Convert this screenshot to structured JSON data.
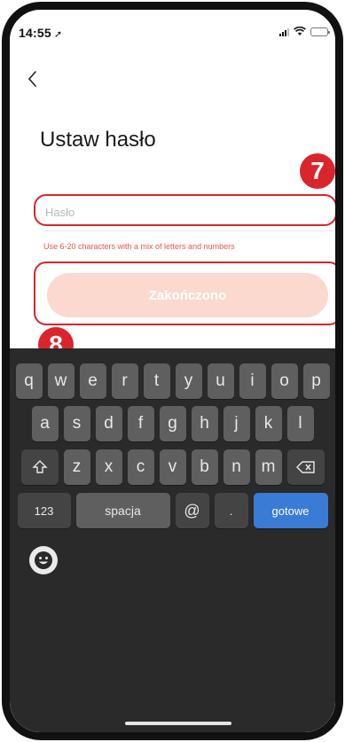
{
  "status_bar": {
    "time": "14:55",
    "location_icon": "location-arrow-icon",
    "signal_icon": "signal-icon",
    "wifi_icon": "wifi-icon",
    "battery_icon": "battery-icon"
  },
  "nav": {
    "back_icon": "chevron-left-icon"
  },
  "page": {
    "title": "Ustaw hasło"
  },
  "form": {
    "password_placeholder": "Hasło",
    "password_value": "",
    "hint": "Use 6-20 characters with a mix of letters and numbers"
  },
  "finish_button": {
    "label": "Zakończono",
    "enabled": false
  },
  "annotations": {
    "badge_7": "7",
    "badge_8": "8",
    "color": "#d9252b"
  },
  "colors": {
    "accent_disabled": "#fbd9ce",
    "hint": "#e8554a",
    "keyboard_go": "#3a7bd5"
  },
  "keyboard": {
    "row1": [
      "q",
      "w",
      "e",
      "r",
      "t",
      "y",
      "u",
      "i",
      "o",
      "p"
    ],
    "row2": [
      "a",
      "s",
      "d",
      "f",
      "g",
      "h",
      "j",
      "k",
      "l"
    ],
    "row3": [
      "z",
      "x",
      "c",
      "v",
      "b",
      "n",
      "m"
    ],
    "numbers_key": "123",
    "space_key": "spacja",
    "at_key": "@",
    "dot_key": ".",
    "done_key": "gotowe",
    "shift_icon": "shift-icon",
    "backspace_icon": "backspace-icon",
    "emoji_icon": "emoji-icon"
  }
}
